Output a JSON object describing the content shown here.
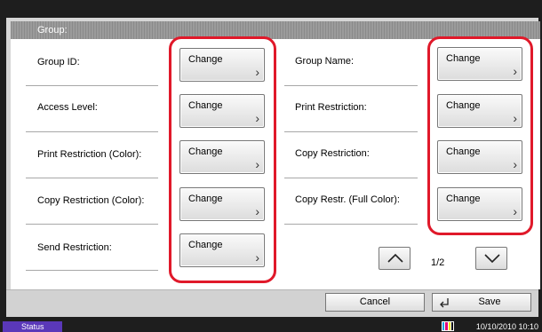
{
  "title": "Group:",
  "change_label": "Change",
  "left_column": [
    {
      "label": "Group ID:"
    },
    {
      "label": "Access Level:"
    },
    {
      "label": "Print Restriction (Color):"
    },
    {
      "label": "Copy Restriction (Color):"
    },
    {
      "label": "Send Restriction:"
    }
  ],
  "right_column": [
    {
      "label": "Group Name:"
    },
    {
      "label": "Print Restriction:"
    },
    {
      "label": "Copy Restriction:"
    },
    {
      "label": "Copy Restr. (Full Color):"
    }
  ],
  "pager": {
    "current": "1/2",
    "up_icon": "chevron-up-icon",
    "down_icon": "chevron-down-icon"
  },
  "footer": {
    "cancel_label": "Cancel",
    "save_label": "Save",
    "save_icon": "enter-icon"
  },
  "statusbar": {
    "status_label": "Status",
    "datetime": "10/10/2010  10:10",
    "toner_colors": [
      "#00a0e0",
      "#e0007a",
      "#f0e000",
      "#111111"
    ]
  },
  "colors": {
    "highlight": "#e0192a",
    "status": "#5a38b9"
  }
}
